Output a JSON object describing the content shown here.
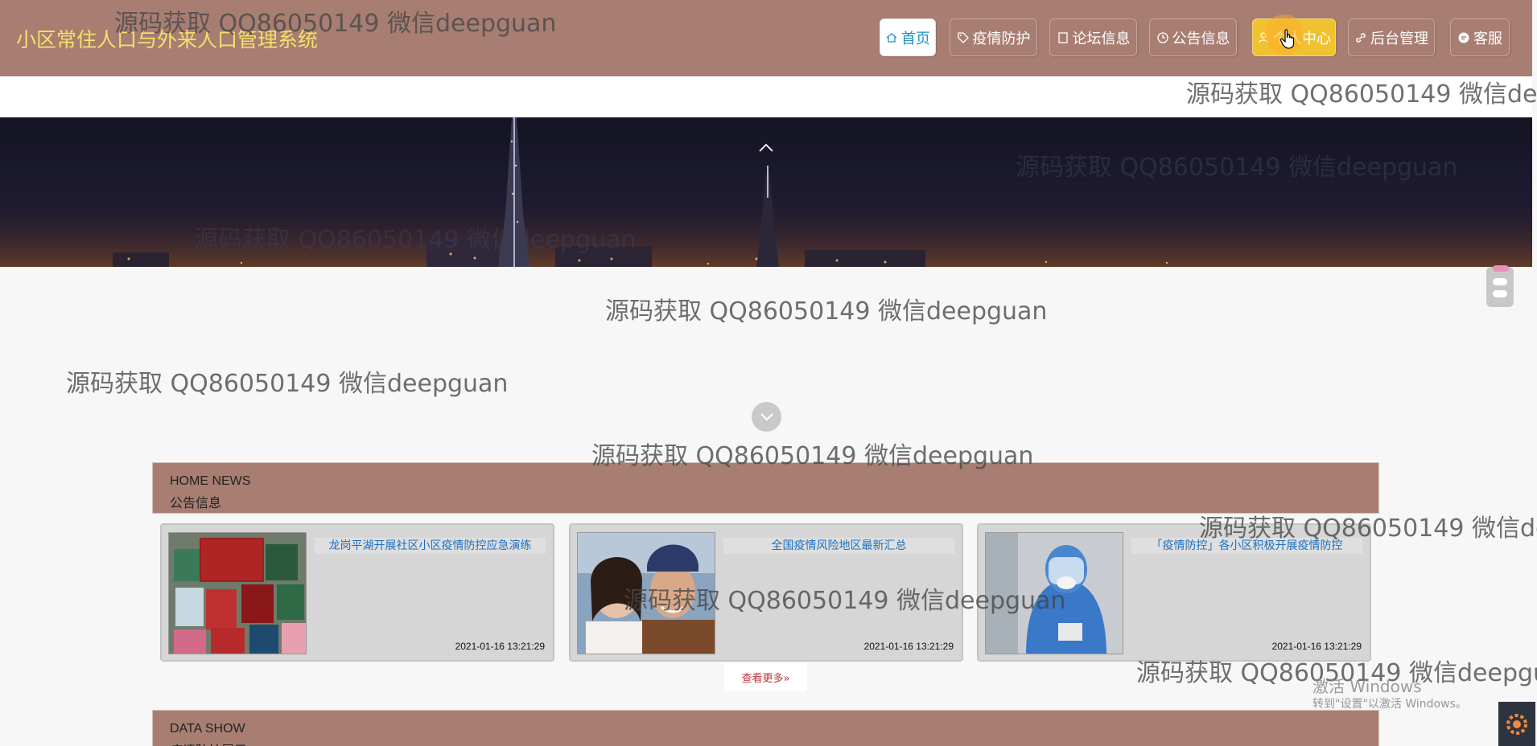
{
  "header": {
    "site_title": "小区常住人口与外来人口管理系统",
    "nav": [
      {
        "label": "首页",
        "icon": "home-icon"
      },
      {
        "label": "疫情防护",
        "icon": "tag-icon"
      },
      {
        "label": "论坛信息",
        "icon": "doc-icon"
      },
      {
        "label": "公告信息",
        "icon": "clock-icon"
      },
      {
        "label": "个人中心",
        "icon": "user-icon"
      },
      {
        "label": "后台管理",
        "icon": "link-icon"
      },
      {
        "label": "客服",
        "icon": "chat-icon"
      }
    ],
    "active_index": 0
  },
  "news_section": {
    "en": "HOME NEWS",
    "cn": "公告信息",
    "items": [
      {
        "title": "龙岗平湖开展社区小区疫情防控应急演练",
        "date": "2021-01-16 13:21:29"
      },
      {
        "title": "全国疫情风险地区最新汇总",
        "date": "2021-01-16 13:21:29"
      },
      {
        "title": "「疫情防控」各小区积极开展疫情防控",
        "date": "2021-01-16 13:21:29"
      }
    ],
    "more_label": "查看更多»"
  },
  "data_section": {
    "en": "DATA SHOW",
    "cn": "疫情防护展示"
  },
  "watermarks": [
    "源码获取 QQ86050149 微信deepguan",
    "源码获取 QQ86050149 微信deepguan",
    "源码获取 QQ86050149 微信deepguan",
    "源码获取 QQ86050149 微信deepguan",
    "源码获取 QQ86050149 微信deepguan",
    "源码获取 QQ86050149 微信deepguan",
    "源码获取 QQ86050149 微信deepguan",
    "源码获取 QQ86050149 微信deepguan",
    "源码获取 QQ86050149 微信deepguan",
    "源码获取 QQ86050149 微信deepguan"
  ],
  "windows_activation": {
    "title": "激活 Windows",
    "subtitle": "转到\"设置\"以激活 Windows。"
  },
  "colors": {
    "header_bg": "#a87e72",
    "title_color": "#f6e06a",
    "active_nav_text": "#1e90c8",
    "user_nav_bg": "#f1c230",
    "news_title_color": "#1e70c0",
    "more_text": "#c0303a"
  }
}
